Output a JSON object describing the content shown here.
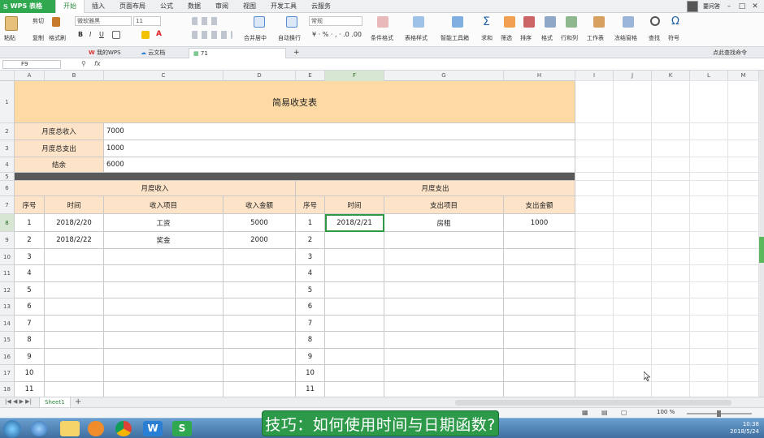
{
  "app": {
    "name": "WPS 表格",
    "menu_tabs": [
      "开始",
      "插入",
      "页面布局",
      "公式",
      "数据",
      "审阅",
      "视图",
      "开发工具",
      "云服务"
    ],
    "active_menu": "开始",
    "user_name": "要问答"
  },
  "ribbon": {
    "paste": "粘贴",
    "cut": "剪切",
    "copy": "复制",
    "format_painter": "格式刷",
    "font_name": "微软雅黑",
    "font_size": "11",
    "merge_center": "合并居中",
    "wrap_text": "自动换行",
    "number_format": "常规",
    "conditional_format": "条件格式",
    "table_style": "表格样式",
    "smart_toolbox": "智能工具箱",
    "sum": "求和",
    "filter": "筛选",
    "sort": "排序",
    "format": "格式",
    "row_col": "行和列",
    "worksheet": "工作表",
    "freeze_panes": "冻结窗格",
    "find": "查找",
    "symbol": "符号"
  },
  "tabs": {
    "my_wps": "我的WPS",
    "cloud_docs": "云文档",
    "doc": "71",
    "search_cmd": "点此查找命令"
  },
  "formula_bar": {
    "name_box": "F9",
    "fx": "fx",
    "content": ""
  },
  "columns": [
    "A",
    "B",
    "C",
    "D",
    "E",
    "F",
    "G",
    "H",
    "I",
    "J",
    "K",
    "L",
    "M"
  ],
  "rows": [
    "1",
    "2",
    "3",
    "4",
    "5",
    "6",
    "7",
    "8",
    "9",
    "10",
    "11",
    "12",
    "13",
    "14",
    "15",
    "16",
    "17",
    "18"
  ],
  "sheet": {
    "title": "简易收支表",
    "summary": [
      {
        "label": "月度总收入",
        "value": "7000"
      },
      {
        "label": "月度总支出",
        "value": "1000"
      },
      {
        "label": "结余",
        "value": "6000"
      }
    ],
    "income_header": "月度收入",
    "expense_header": "月度支出",
    "income_columns": [
      "序号",
      "时间",
      "收入项目",
      "收入金额"
    ],
    "expense_columns": [
      "序号",
      "时间",
      "支出项目",
      "支出金额"
    ],
    "income_rows": [
      [
        "1",
        "2018/2/20",
        "工资",
        "5000"
      ],
      [
        "2",
        "2018/2/22",
        "奖金",
        "2000"
      ],
      [
        "3",
        "",
        "",
        ""
      ],
      [
        "4",
        "",
        "",
        ""
      ],
      [
        "5",
        "",
        "",
        ""
      ],
      [
        "6",
        "",
        "",
        ""
      ],
      [
        "7",
        "",
        "",
        ""
      ],
      [
        "8",
        "",
        "",
        ""
      ],
      [
        "9",
        "",
        "",
        ""
      ],
      [
        "10",
        "",
        "",
        ""
      ],
      [
        "11",
        "",
        "",
        ""
      ]
    ],
    "expense_rows": [
      [
        "1",
        "2018/2/21",
        "房租",
        "1000"
      ],
      [
        "2",
        "",
        "",
        ""
      ],
      [
        "3",
        "",
        "",
        ""
      ],
      [
        "4",
        "",
        "",
        ""
      ],
      [
        "5",
        "",
        "",
        ""
      ],
      [
        "6",
        "",
        "",
        ""
      ],
      [
        "7",
        "",
        "",
        ""
      ],
      [
        "8",
        "",
        "",
        ""
      ],
      [
        "9",
        "",
        "",
        ""
      ],
      [
        "10",
        "",
        "",
        ""
      ],
      [
        "11",
        "",
        "",
        ""
      ]
    ]
  },
  "sheet_tabs": [
    "Sheet1"
  ],
  "status": {
    "zoom": "100 %"
  },
  "taskbar": {
    "time": "10:38",
    "date": "2018/5/24"
  },
  "caption": "技巧：如何使用时间与日期函数?",
  "colors": {
    "accent_green": "#2fa84f",
    "title_fill": "#fdd9a4",
    "header_fill": "#fde3c8",
    "band": "#5a5a5a"
  }
}
